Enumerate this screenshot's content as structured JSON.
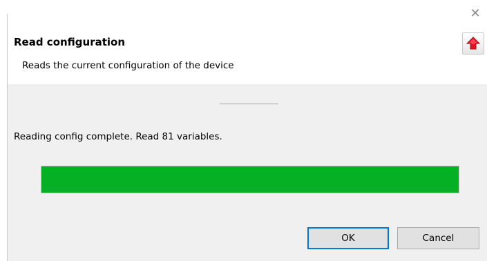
{
  "dialog": {
    "title": "Read configuration",
    "subtitle": "Reads the current configuration of the device",
    "close_icon": "close-icon",
    "header_icon": "red-up-arrow-icon"
  },
  "status": {
    "message": "Reading config complete. Read 81 variables."
  },
  "progress": {
    "percent": 100,
    "fill_color": "#06b025"
  },
  "buttons": {
    "ok_label": "OK",
    "cancel_label": "Cancel"
  },
  "colors": {
    "header_bg": "#ffffff",
    "body_bg": "#f0f0f0",
    "accent": "#0078d7",
    "arrow_red": "#e81123"
  }
}
